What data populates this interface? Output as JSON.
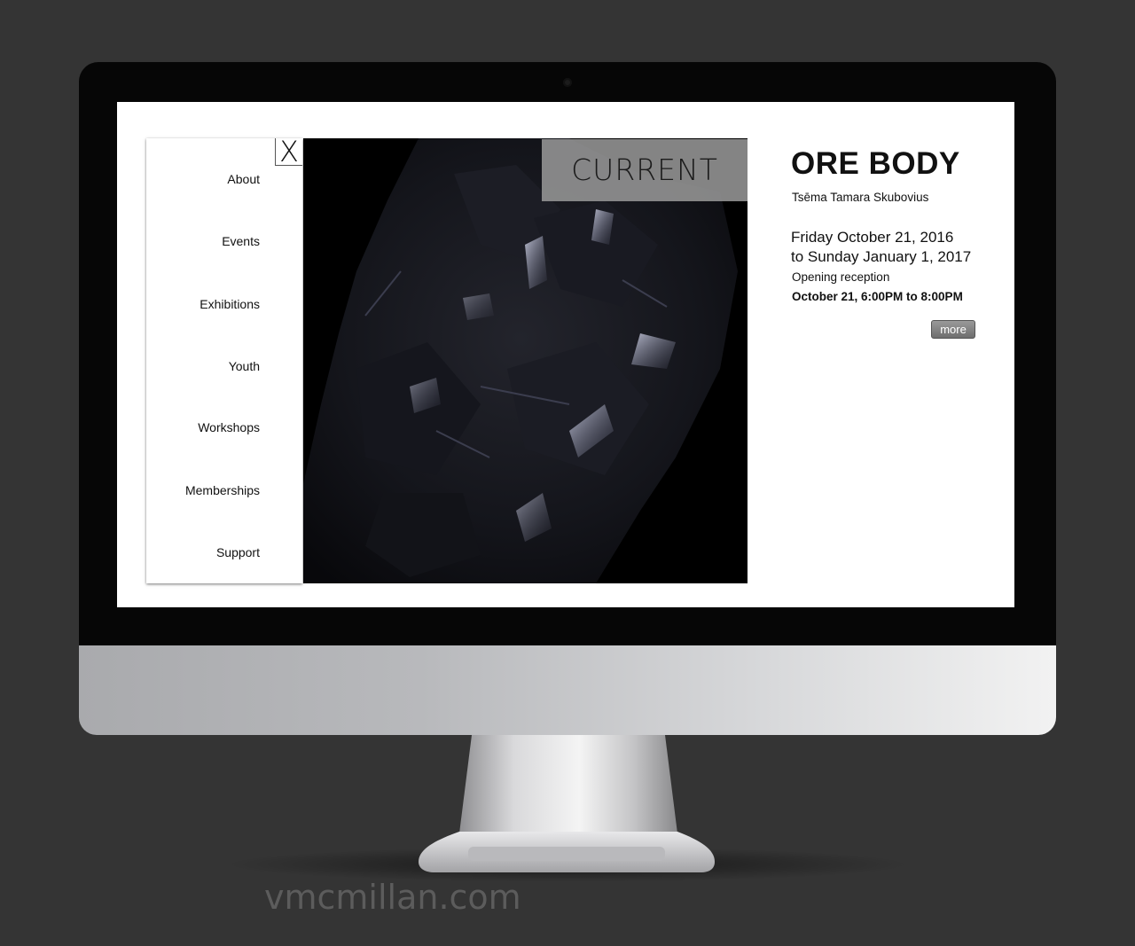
{
  "nav": {
    "close_label": "X",
    "items": [
      {
        "label": "About"
      },
      {
        "label": "Events"
      },
      {
        "label": "Exhibitions"
      },
      {
        "label": "Youth"
      },
      {
        "label": "Workshops"
      },
      {
        "label": "Memberships"
      },
      {
        "label": "Support"
      }
    ]
  },
  "hero": {
    "tag": "CURRENT"
  },
  "exhibition": {
    "title": "ORE BODY",
    "artist": "Tsēma Tamara Skubovius",
    "date_start": "Friday October 21, 2016",
    "date_end": "to Sunday January 1, 2017",
    "reception_label": "Opening reception",
    "reception_time": "October 21, 6:00PM to 8:00PM",
    "more_label": "more"
  },
  "watermark": "vmcmillan.com"
}
